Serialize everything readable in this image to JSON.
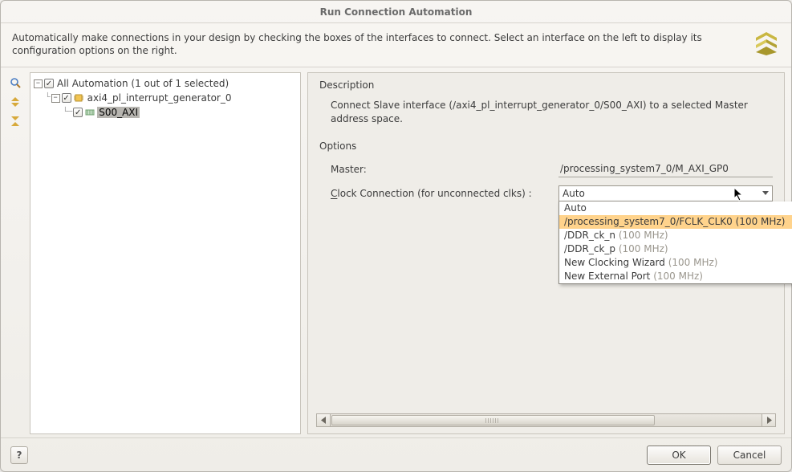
{
  "title": "Run Connection Automation",
  "intro": "Automatically make connections in your design by checking the boxes of the interfaces to connect. Select an interface on the left to display its configuration options on the right.",
  "tree": {
    "root_label": "All Automation (1 out of 1 selected)",
    "child1_label": "axi4_pl_interrupt_generator_0",
    "child2_label": "S00_AXI"
  },
  "detail": {
    "description_heading": "Description",
    "description_text": "Connect Slave interface (/axi4_pl_interrupt_generator_0/S00_AXI) to a selected Master address space.",
    "options_heading": "Options",
    "master_label": "Master:",
    "master_value": "/processing_system7_0/M_AXI_GP0",
    "clock_label_pre": "C",
    "clock_label_post": "lock Connection (for unconnected clks) :",
    "clock_value": "Auto",
    "dropdown": {
      "i0": "Auto",
      "i1": "/processing_system7_0/FCLK_CLK0 (100 MHz)",
      "i2": "/DDR_ck_n ",
      "i3": "/DDR_ck_p ",
      "i4": "New Clocking Wizard ",
      "i5": "New External Port ",
      "muted": "(100 MHz)"
    }
  },
  "footer": {
    "help": "?",
    "ok": "OK",
    "cancel": "Cancel"
  }
}
